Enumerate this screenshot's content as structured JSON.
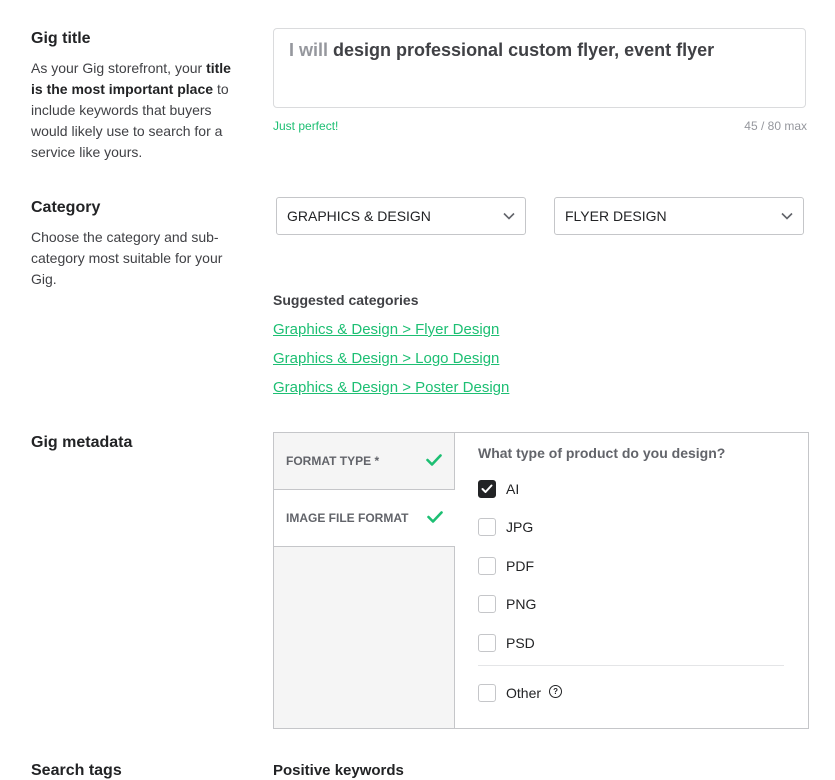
{
  "gig_title": {
    "heading": "Gig title",
    "desc_1": "As your Gig storefront, your",
    "desc_bold": "title is the most important place",
    "desc_2": "to include keywords that buyers would likely use to search for a service like yours.",
    "value_prefix": "I will",
    "value": "design professional custom flyer, event flyer",
    "status": "Just perfect!",
    "counter": "45 / 80 max"
  },
  "category": {
    "heading": "Category",
    "desc": "Choose the category and sub-category most suitable for your Gig.",
    "selected_category": "GRAPHICS & DESIGN",
    "selected_subcategory": "FLYER DESIGN",
    "suggested_heading": "Suggested categories",
    "suggestions": [
      "Graphics & Design > Flyer Design",
      "Graphics & Design > Logo Design",
      "Graphics & Design > Poster Design"
    ]
  },
  "metadata": {
    "heading": "Gig metadata",
    "tabs": [
      {
        "label": "FORMAT TYPE *",
        "complete": true
      },
      {
        "label": "IMAGE FILE FORMAT",
        "complete": true
      }
    ],
    "question": "What type of product do you design?",
    "options": [
      {
        "label": "AI",
        "checked": true
      },
      {
        "label": "JPG",
        "checked": false
      },
      {
        "label": "PDF",
        "checked": false
      },
      {
        "label": "PNG",
        "checked": false
      },
      {
        "label": "PSD",
        "checked": false
      }
    ],
    "other_label": "Other"
  },
  "search_tags": {
    "heading": "Search tags",
    "positive_keywords": "Positive keywords"
  },
  "colors": {
    "accent": "#1dbf73",
    "text": "#404145",
    "border": "#c5c6c9"
  }
}
